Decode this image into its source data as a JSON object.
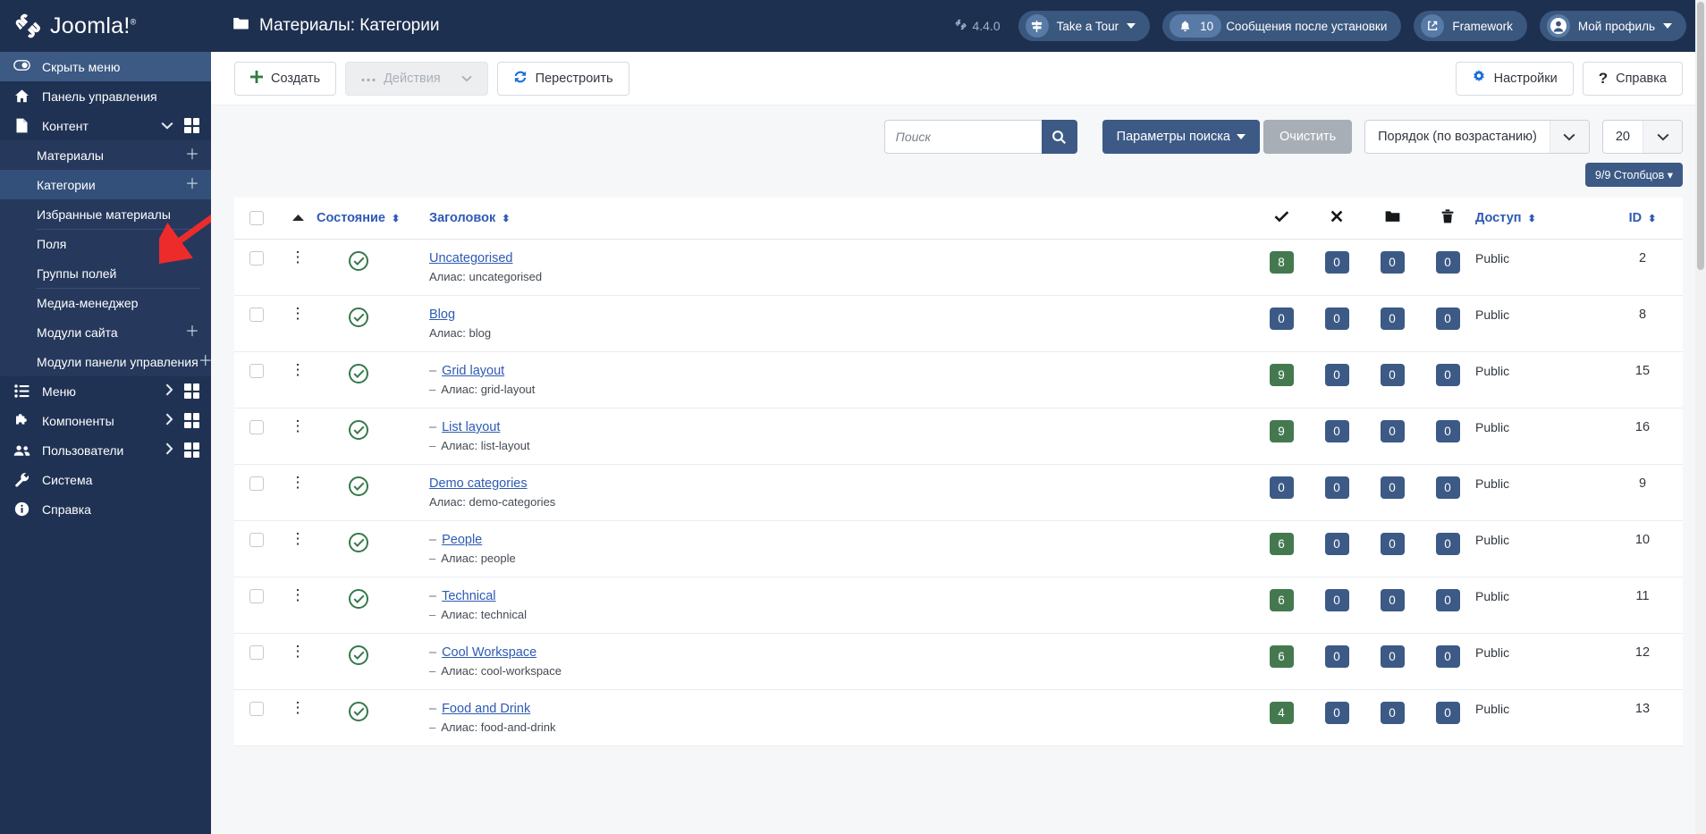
{
  "brand": {
    "name": "Joomla!",
    "logo_icon": "joomla-logo-icon"
  },
  "header": {
    "page_title": "Материалы: Категории",
    "folder_icon": "folder-icon",
    "version": "4.4.0",
    "version_icon": "joomla-mark-icon",
    "take_a_tour": "Take a Tour",
    "tour_icon": "signpost-icon",
    "notifications_count": "10",
    "bell_icon": "bell-icon",
    "notifications_label": "Сообщения после установки",
    "framework": "Framework",
    "framework_icon": "external-link-icon",
    "profile": "Мой профиль",
    "profile_icon": "user-circle-icon"
  },
  "sidebar": {
    "toggle_label": "Скрыть меню",
    "toggle_icon": "toggle-switch-icon",
    "items": [
      {
        "label": "Панель управления",
        "icon": "home-icon",
        "type": "item"
      },
      {
        "label": "Контент",
        "icon": "document-icon",
        "type": "item",
        "chevron": "chevron-down-icon",
        "grid": true,
        "expanded": true
      },
      {
        "label": "Материалы",
        "type": "sub",
        "plus": true
      },
      {
        "label": "Категории",
        "type": "sub",
        "plus": true,
        "active": true
      },
      {
        "label": "Избранные материалы",
        "type": "sub"
      },
      {
        "label": "Поля",
        "type": "sub",
        "separator": true
      },
      {
        "label": "Группы полей",
        "type": "sub"
      },
      {
        "label": "Медиа-менеджер",
        "type": "sub",
        "separator": true
      },
      {
        "label": "Модули сайта",
        "type": "sub",
        "plus": true
      },
      {
        "label": "Модули панели управления",
        "type": "sub",
        "plus": true
      },
      {
        "label": "Меню",
        "icon": "list-icon",
        "type": "item",
        "chevron": "chevron-right-icon",
        "grid": true
      },
      {
        "label": "Компоненты",
        "icon": "puzzle-icon",
        "type": "item",
        "chevron": "chevron-right-icon",
        "grid": true
      },
      {
        "label": "Пользователи",
        "icon": "users-icon",
        "type": "item",
        "chevron": "chevron-right-icon",
        "grid": true
      },
      {
        "label": "Система",
        "icon": "wrench-icon",
        "type": "item"
      },
      {
        "label": "Справка",
        "icon": "info-icon",
        "type": "item"
      }
    ]
  },
  "toolbar": {
    "new_label": "Создать",
    "new_icon": "plus-icon",
    "actions_label": "Действия",
    "actions_icon": "ellipsis-icon",
    "actions_caret": "chevron-down-icon",
    "rebuild_label": "Перестроить",
    "rebuild_icon": "refresh-icon",
    "options_label": "Настройки",
    "options_icon": "gear-icon",
    "help_label": "Справка",
    "help_icon": "question-icon"
  },
  "filters": {
    "search_placeholder": "Поиск",
    "search_value": "",
    "search_icon": "search-icon",
    "search_tools_label": "Параметры поиска",
    "search_tools_caret": "chevron-down-icon",
    "clear_label": "Очистить",
    "ordering_value": "Порядок (по возрастанию)",
    "limit_value": "20",
    "columns_label": "9/9 Столбцов"
  },
  "table": {
    "columns": {
      "checkbox": "",
      "ordering_icon": "sort-asc-icon",
      "status": "Состояние",
      "title": "Заголовок",
      "published_icon": "check-icon",
      "unpublished_icon": "times-icon",
      "archived_icon": "folder-icon",
      "trashed_icon": "trash-icon",
      "access": "Доступ",
      "id": "ID"
    },
    "alias_prefix": "Алиас:",
    "rows": [
      {
        "title": "Uncategorised",
        "alias": "uncategorised",
        "level": 0,
        "status_icon": "check-circle-icon",
        "counts": [
          "8",
          "0",
          "0",
          "0"
        ],
        "count_styles": [
          "green",
          "blue",
          "blue",
          "blue"
        ],
        "access": "Public",
        "id": "2"
      },
      {
        "title": "Blog",
        "alias": "blog",
        "level": 0,
        "status_icon": "check-circle-icon",
        "counts": [
          "0",
          "0",
          "0",
          "0"
        ],
        "count_styles": [
          "blue",
          "blue",
          "blue",
          "blue"
        ],
        "access": "Public",
        "id": "8"
      },
      {
        "title": "Grid layout",
        "alias": "grid-layout",
        "level": 1,
        "status_icon": "check-circle-icon",
        "counts": [
          "9",
          "0",
          "0",
          "0"
        ],
        "count_styles": [
          "green",
          "blue",
          "blue",
          "blue"
        ],
        "access": "Public",
        "id": "15"
      },
      {
        "title": "List layout",
        "alias": "list-layout",
        "level": 1,
        "status_icon": "check-circle-icon",
        "counts": [
          "9",
          "0",
          "0",
          "0"
        ],
        "count_styles": [
          "green",
          "blue",
          "blue",
          "blue"
        ],
        "access": "Public",
        "id": "16"
      },
      {
        "title": "Demo categories",
        "alias": "demo-categories",
        "level": 0,
        "status_icon": "check-circle-icon",
        "counts": [
          "0",
          "0",
          "0",
          "0"
        ],
        "count_styles": [
          "blue",
          "blue",
          "blue",
          "blue"
        ],
        "access": "Public",
        "id": "9"
      },
      {
        "title": "People",
        "alias": "people",
        "level": 1,
        "status_icon": "check-circle-icon",
        "counts": [
          "6",
          "0",
          "0",
          "0"
        ],
        "count_styles": [
          "green",
          "blue",
          "blue",
          "blue"
        ],
        "access": "Public",
        "id": "10"
      },
      {
        "title": "Technical",
        "alias": "technical",
        "level": 1,
        "status_icon": "check-circle-icon",
        "counts": [
          "6",
          "0",
          "0",
          "0"
        ],
        "count_styles": [
          "green",
          "blue",
          "blue",
          "blue"
        ],
        "access": "Public",
        "id": "11"
      },
      {
        "title": "Cool Workspace",
        "alias": "cool-workspace",
        "level": 1,
        "status_icon": "check-circle-icon",
        "counts": [
          "6",
          "0",
          "0",
          "0"
        ],
        "count_styles": [
          "green",
          "blue",
          "blue",
          "blue"
        ],
        "access": "Public",
        "id": "12"
      },
      {
        "title": "Food and Drink",
        "alias": "food-and-drink",
        "level": 1,
        "status_icon": "check-circle-icon",
        "counts": [
          "4",
          "0",
          "0",
          "0"
        ],
        "count_styles": [
          "green",
          "blue",
          "blue",
          "blue"
        ],
        "access": "Public",
        "id": "13"
      }
    ]
  },
  "annotation": {
    "arrow_color": "#ee2b2b",
    "arrow_icon": "pointer-arrow-icon"
  }
}
